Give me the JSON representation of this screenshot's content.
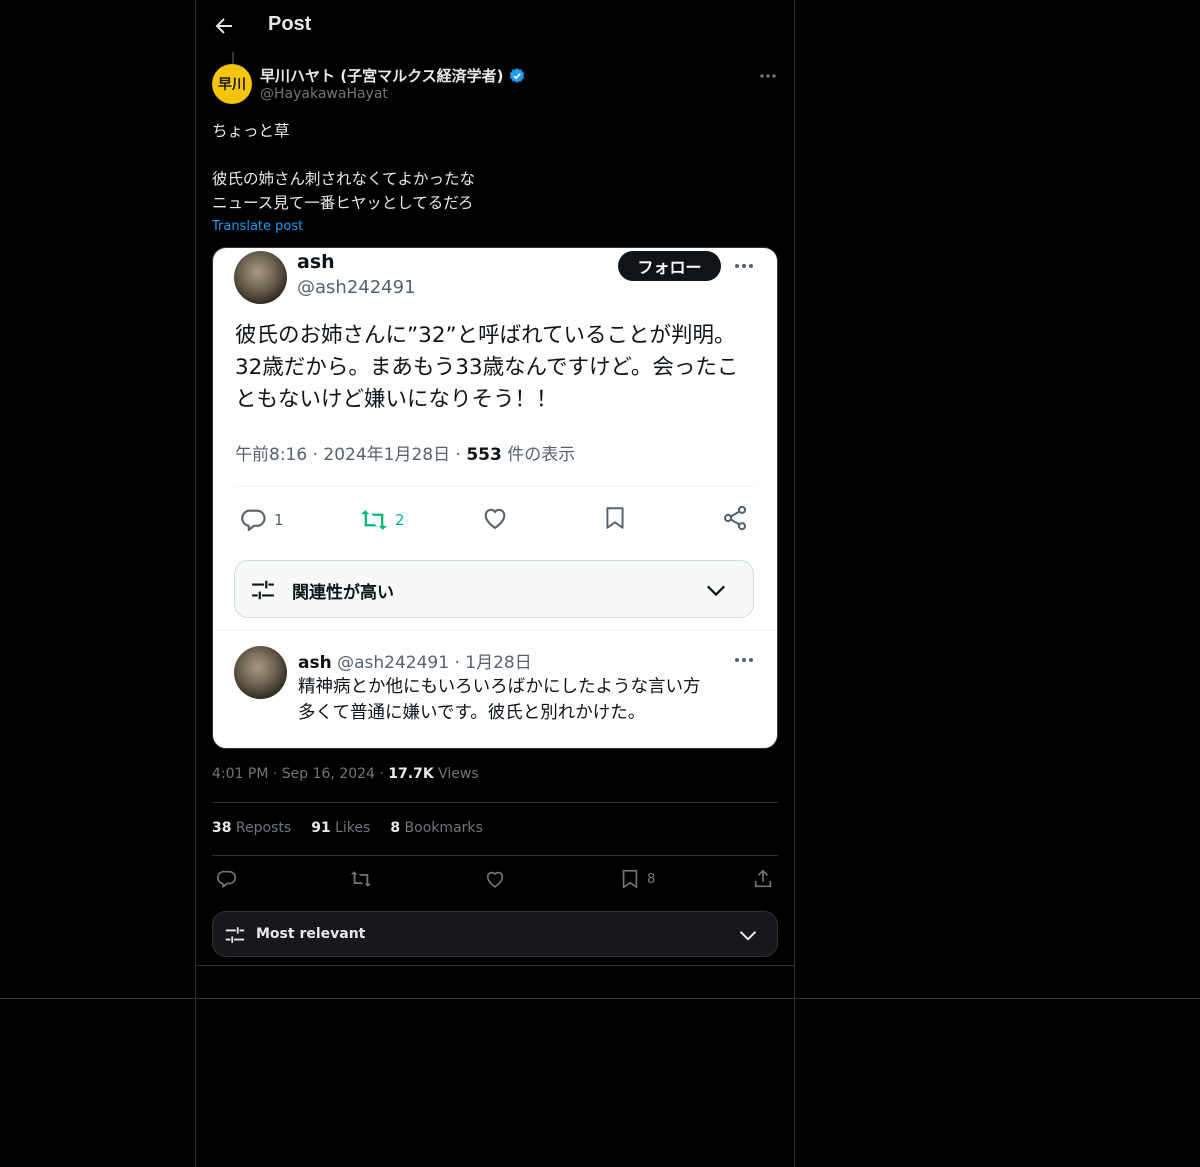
{
  "header": {
    "title": "Post"
  },
  "post": {
    "author_name": "早川ハヤト (子宮マルクス経済学者)",
    "author_handle": "@HayakawaHayat",
    "avatar_text": "早川",
    "text_lines": [
      "ちょっと草",
      "彼氏の姉さん刺されなくてよかったな",
      "ニュース見て一番ヒヤッとしてるだろ"
    ],
    "translate_label": "Translate post",
    "timestamp": "4:01 PM · Sep 16, 2024 · ",
    "views_count": "17.7K",
    "views_label": " Views",
    "stats": {
      "reposts_count": "38",
      "reposts_label": " Reposts",
      "likes_count": "91",
      "likes_label": " Likes",
      "bookmarks_count": "8",
      "bookmarks_label": " Bookmarks"
    },
    "bookmark_action_count": "8",
    "sort_label": "Most relevant"
  },
  "embedded": {
    "author_name": "ash",
    "author_handle": "@ash242491",
    "follow_label": "フォロー",
    "text_lines": [
      "彼氏のお姉さんに”32”と呼ばれていることが判明。",
      "32歳だから。まあもう33歳なんですけど。会ったこ",
      "ともないけど嫌いになりそう！！"
    ],
    "meta_prefix": "午前8:16 · 2024年1月28日 · ",
    "meta_views": "553",
    "meta_suffix": " 件の表示",
    "reply_count": "1",
    "repost_count": "2",
    "sort_label": "関連性が高い",
    "reply": {
      "author_name": "ash",
      "meta": " @ash242491 · 1月28日",
      "text_lines": [
        "精神病とか他にもいろいろばかにしたような言い方",
        "多くて普通に嫌いです。彼氏と別れかけた。"
      ]
    }
  },
  "colors": {
    "accent": "#1d9bf0",
    "repost_green": "#00ba7c",
    "avatar_yellow": "#f5c40c",
    "background": "#000000"
  },
  "icons": [
    "back-arrow-icon",
    "verified-badge-icon",
    "more-icon",
    "reply-icon",
    "repost-icon",
    "like-icon",
    "bookmark-icon",
    "share-icon",
    "sort-sliders-icon",
    "chevron-down-icon"
  ]
}
